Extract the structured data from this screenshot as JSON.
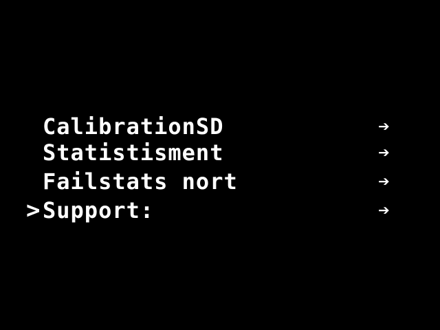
{
  "menu": {
    "cursor": ">",
    "items": [
      {
        "label": "CalibrationSD",
        "arrow": "➔",
        "selected": false
      },
      {
        "label": "Statistisment",
        "arrow": "➔",
        "selected": false
      },
      {
        "label": "Failstats nort",
        "arrow": "➔",
        "selected": false
      },
      {
        "label": "Support:",
        "arrow": "➔",
        "selected": true
      }
    ]
  },
  "colors": {
    "background": "#000000",
    "foreground": "#ffffff"
  }
}
